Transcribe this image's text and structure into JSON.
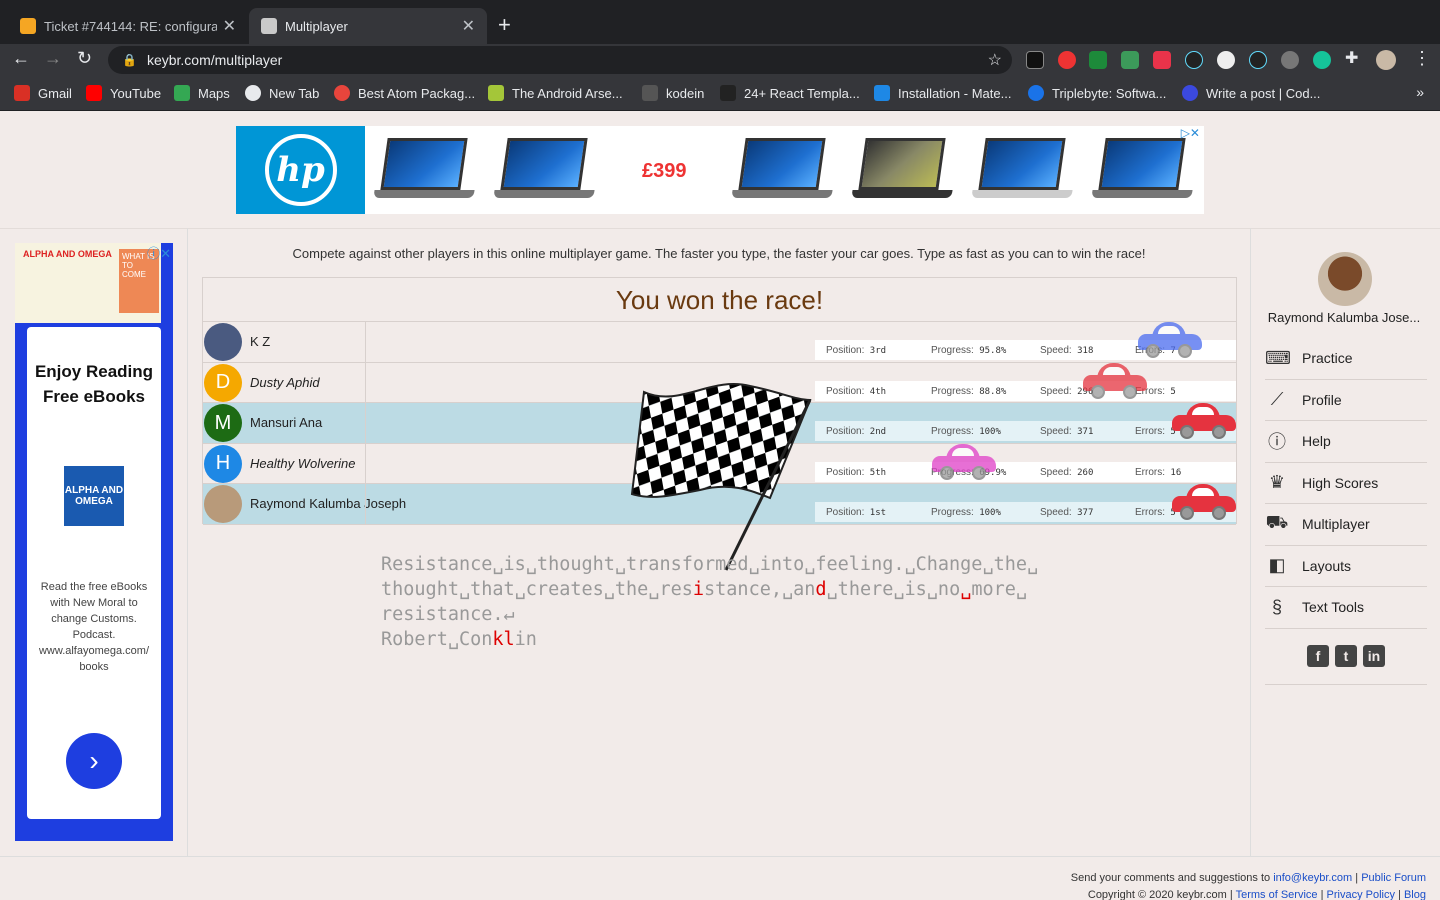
{
  "browser": {
    "tabs": [
      {
        "title": "Ticket #744144: RE: configurat",
        "active": false,
        "favicon_color": "#f5a623"
      },
      {
        "title": "Multiplayer",
        "active": true,
        "favicon_color": "#c9c9c9"
      }
    ],
    "url": "keybr.com/multiplayer",
    "bookmarks": [
      {
        "label": "Gmail",
        "color": "#d93025"
      },
      {
        "label": "YouTube",
        "color": "#ff0000"
      },
      {
        "label": "Maps",
        "color": "#34a853"
      },
      {
        "label": "New Tab",
        "color": "#e8eaed"
      },
      {
        "label": "Best Atom Packag...",
        "color": "#e8453c"
      },
      {
        "label": "The Android Arse...",
        "color": "#a4c639"
      },
      {
        "label": "kodein",
        "color": "#555555"
      },
      {
        "label": "24+ React Templa...",
        "color": "#222222"
      },
      {
        "label": "Installation - Mate...",
        "color": "#1e88e5"
      },
      {
        "label": "Triplebyte: Softwa...",
        "color": "#1a73e8"
      },
      {
        "label": "Write a post | Cod...",
        "color": "#3b49df"
      }
    ]
  },
  "ad_banner": {
    "brand": "hp",
    "price": "£399"
  },
  "side_ad": {
    "top_banner": "ALPHA AND OMEGA",
    "top_corner": "WHAT IS TO COME",
    "headline": "Enjoy Reading Free eBooks",
    "logo_text": "ALPHA AND OMEGA",
    "description": "Read the free eBooks with New Moral to change Customs. Podcast. www.alfayomega.com/ books"
  },
  "intro": "Compete against other players in this online multiplayer game. The faster you type, the faster your car goes. Type as fast as you can to win the race!",
  "race": {
    "result": "You won the race!",
    "labels": {
      "position": "Position:",
      "progress": "Progress:",
      "speed": "Speed:",
      "errors": "Errors:"
    },
    "players": [
      {
        "name": "K Z",
        "initial": "",
        "avatar_color": "#4a5a80",
        "italic": false,
        "highlight": false,
        "position": "3rd",
        "progress": "95.8%",
        "speed": "318",
        "errors": "7",
        "car_color": "#4a6cf0",
        "progress_fraction": 0.958
      },
      {
        "name": "Dusty Aphid",
        "initial": "D",
        "avatar_color": "#f5a800",
        "italic": true,
        "highlight": false,
        "position": "4th",
        "progress": "88.8%",
        "speed": "296",
        "errors": "5",
        "car_color": "#e5333f",
        "progress_fraction": 0.888
      },
      {
        "name": "Mansuri Ana",
        "initial": "M",
        "avatar_color": "#1d6b14",
        "italic": false,
        "highlight": true,
        "position": "2nd",
        "progress": "100%",
        "speed": "371",
        "errors": "5",
        "car_color": "#e5333f",
        "progress_fraction": 1.0
      },
      {
        "name": "Healthy Wolverine",
        "initial": "H",
        "avatar_color": "#1e88e5",
        "italic": true,
        "highlight": false,
        "position": "5th",
        "progress": "69.9%",
        "speed": "260",
        "errors": "16",
        "car_color": "#e040c8",
        "progress_fraction": 0.699
      },
      {
        "name": "Raymond Kalumba Joseph",
        "initial": "",
        "avatar_color": "#b89a7a",
        "italic": false,
        "highlight": true,
        "position": "1st",
        "progress": "100%",
        "speed": "377",
        "errors": "5",
        "car_color": "#e5333f",
        "progress_fraction": 1.0
      }
    ]
  },
  "typing_text": {
    "line1": "Resistance␣is␣thought␣transformed␣into␣feeling.␣Change␣the␣",
    "line2_a": "thought␣that␣creates␣the␣res",
    "line2_err1": "i",
    "line2_b": "stance,␣an",
    "line2_err2": "d",
    "line2_c": "␣there␣is␣no",
    "line2_err3": "␣",
    "line2_d": "more␣",
    "line3": "resistance.↵",
    "line4_a": "Robert␣Con",
    "line4_err": "kl",
    "line4_b": "in"
  },
  "user": {
    "name": "Raymond Kalumba Jose..."
  },
  "menu": [
    {
      "label": "Practice",
      "icon": "keyboard-icon",
      "glyph": "⌨"
    },
    {
      "label": "Profile",
      "icon": "chart-icon",
      "glyph": "📈"
    },
    {
      "label": "Help",
      "icon": "help-icon",
      "glyph": "?"
    },
    {
      "label": "High Scores",
      "icon": "trophy-icon",
      "glyph": "🏆"
    },
    {
      "label": "Multiplayer",
      "icon": "car-icon",
      "glyph": "🚗"
    },
    {
      "label": "Layouts",
      "icon": "layouts-icon",
      "glyph": "◧"
    },
    {
      "label": "Text Tools",
      "icon": "section-icon",
      "glyph": "§"
    }
  ],
  "footer": {
    "line1_text": "Send your comments and suggestions to",
    "email": "info@keybr.com",
    "forum": "Public Forum",
    "copyright": "Copyright © 2020 keybr.com",
    "terms": "Terms of Service",
    "privacy": "Privacy Policy",
    "blog": "Blog"
  }
}
